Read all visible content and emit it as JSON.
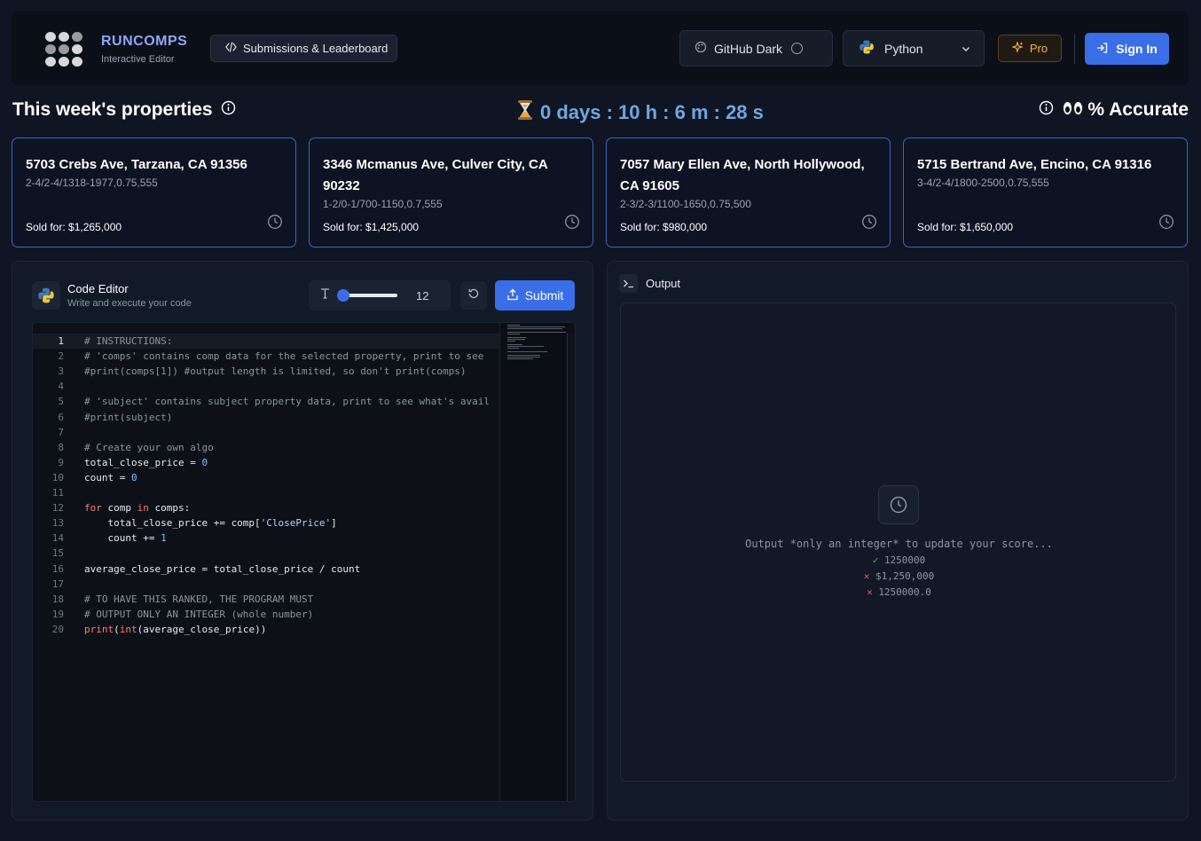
{
  "header": {
    "brand_title": "RUNCOMPS",
    "brand_subtitle": "Interactive Editor",
    "submissions_label": "Submissions & Leaderboard",
    "theme_label": "GitHub Dark",
    "language_label": "Python",
    "pro_label": "Pro",
    "signin_label": "Sign In"
  },
  "week": {
    "title": "This week's properties",
    "timer": "0 days : 10 h : 6 m : 28 s",
    "accuracy_label": "% Accurate"
  },
  "properties": [
    {
      "address": "5703 Crebs Ave, Tarzana, CA 91356",
      "details": "2-4/2-4/1318-1977,0.75,555",
      "sold": "Sold for: $1,265,000"
    },
    {
      "address": "3346 Mcmanus Ave, Culver City, CA 90232",
      "details": "1-2/0-1/700-1150,0.7,555",
      "sold": "Sold for: $1,425,000"
    },
    {
      "address": "7057 Mary Ellen Ave, North Hollywood, CA 91605",
      "details": "2-3/2-3/1100-1650,0.75,500",
      "sold": "Sold for: $980,000"
    },
    {
      "address": "5715 Bertrand Ave, Encino, CA 91316",
      "details": "3-4/2-4/1800-2500,0.75,555",
      "sold": "Sold for: $1,650,000"
    }
  ],
  "editor": {
    "title": "Code Editor",
    "subtitle": "Write and execute your code",
    "font_size": "12",
    "submit_label": "Submit",
    "lines": [
      [
        [
          "c-com",
          "# INSTRUCTIONS:"
        ]
      ],
      [
        [
          "c-com",
          "# 'comps' contains comp data for the selected property, print to see"
        ]
      ],
      [
        [
          "c-com",
          "#print(comps[1]) #output length is limited, so don't print(comps)"
        ]
      ],
      [],
      [
        [
          "c-com",
          "# 'subject' contains subject property data, print to see what's avail"
        ]
      ],
      [
        [
          "c-com",
          "#print(subject)"
        ]
      ],
      [],
      [
        [
          "c-com",
          "# Create your own algo"
        ]
      ],
      [
        [
          "c-pl",
          "total_close_price = "
        ],
        [
          "c-num",
          "0"
        ]
      ],
      [
        [
          "c-pl",
          "count = "
        ],
        [
          "c-num",
          "0"
        ]
      ],
      [],
      [
        [
          "c-kw",
          "for"
        ],
        [
          "c-pl",
          " comp "
        ],
        [
          "c-kw",
          "in"
        ],
        [
          "c-pl",
          " comps:"
        ]
      ],
      [
        [
          "c-pl",
          "    total_close_price += comp["
        ],
        [
          "c-str",
          "'ClosePrice'"
        ],
        [
          "c-pl",
          "]"
        ]
      ],
      [
        [
          "c-pl",
          "    count += "
        ],
        [
          "c-num",
          "1"
        ]
      ],
      [],
      [
        [
          "c-pl",
          "average_close_price = total_close_price / count"
        ]
      ],
      [],
      [
        [
          "c-com",
          "# TO HAVE THIS RANKED, THE PROGRAM MUST"
        ]
      ],
      [
        [
          "c-com",
          "# OUTPUT ONLY AN INTEGER (whole number)"
        ]
      ],
      [
        [
          "c-kw",
          "print"
        ],
        [
          "c-pl",
          "("
        ],
        [
          "c-kw",
          "int"
        ],
        [
          "c-pl",
          "(average_close_price))"
        ]
      ]
    ]
  },
  "output": {
    "title": "Output",
    "message": "Output *only an integer* to update your score...",
    "examples": [
      {
        "mark": "✓",
        "ok": true,
        "text": "1250000"
      },
      {
        "mark": "✕",
        "ok": false,
        "text": "$1,250,000"
      },
      {
        "mark": "✕",
        "ok": false,
        "text": "1250000.0"
      }
    ]
  },
  "colors": {
    "accent": "#3a6ee8",
    "background": "#0f1522",
    "card_border": "#3d64c8",
    "timer": "#6fa7e0",
    "pro": "#f2b545"
  }
}
